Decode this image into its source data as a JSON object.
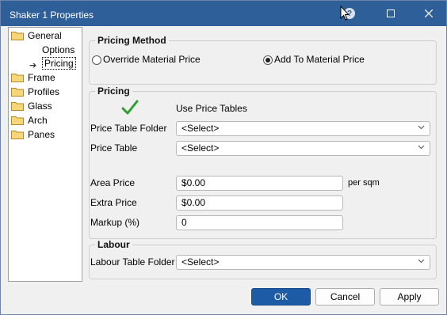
{
  "window": {
    "title": "Shaker 1 Properties"
  },
  "tree": {
    "items": [
      {
        "label": "General",
        "icon": "folder-icon"
      },
      {
        "label": "Options"
      },
      {
        "label": "Pricing",
        "selected": true
      },
      {
        "label": "Frame",
        "icon": "folder-icon"
      },
      {
        "label": "Profiles",
        "icon": "folder-icon"
      },
      {
        "label": "Glass",
        "icon": "folder-icon"
      },
      {
        "label": "Arch",
        "icon": "folder-icon"
      },
      {
        "label": "Panes",
        "icon": "folder-icon"
      }
    ]
  },
  "pricing_method": {
    "title": "Pricing Method",
    "options": [
      {
        "label": "Override Material Price",
        "checked": false
      },
      {
        "label": "Add To Material Price",
        "checked": true
      }
    ]
  },
  "pricing": {
    "title": "Pricing",
    "use_price_tables": {
      "label": "Use Price Tables",
      "checked": true
    },
    "price_table_folder": {
      "label": "Price Table Folder",
      "value": "<Select>"
    },
    "price_table": {
      "label": "Price Table",
      "value": "<Select>"
    },
    "area_price": {
      "label": "Area Price",
      "value": "$0.00",
      "unit": "per sqm"
    },
    "extra_price": {
      "label": "Extra Price",
      "value": "$0.00"
    },
    "markup": {
      "label": "Markup (%)",
      "value": "0"
    }
  },
  "labour": {
    "title": "Labour",
    "labour_table_folder": {
      "label": "Labour Table Folder",
      "value": "<Select>"
    }
  },
  "buttons": {
    "ok": "OK",
    "cancel": "Cancel",
    "apply": "Apply"
  },
  "colors": {
    "titlebar": "#2f5f98",
    "primary_button": "#1e5ba6",
    "check": "#2e9e2e",
    "folder": "#e8c766"
  }
}
